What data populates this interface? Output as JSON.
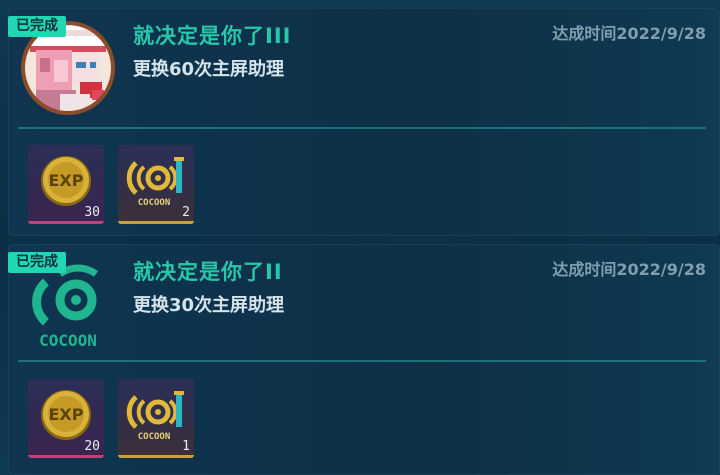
{
  "status_label": "已完成",
  "achievements": [
    {
      "title": "就决定是你了III",
      "description": "更换60次主屏助理",
      "date": "达成时间2022/9/28",
      "icon": "assistant-portrait-icon",
      "rewards": [
        {
          "type": "exp",
          "icon": "exp-coin-icon",
          "label": "EXP",
          "count": "30"
        },
        {
          "type": "cocoon",
          "icon": "cocoon-token-icon",
          "label": "COCOON",
          "count": "2"
        }
      ]
    },
    {
      "title": "就决定是你了II",
      "description": "更换30次主屏助理",
      "date": "达成时间2022/9/28",
      "icon": "cocoon-logo-icon",
      "logo_text": "COCOON",
      "rewards": [
        {
          "type": "exp",
          "icon": "exp-coin-icon",
          "label": "EXP",
          "count": "20"
        },
        {
          "type": "cocoon",
          "icon": "cocoon-token-icon",
          "label": "COCOON",
          "count": "1"
        }
      ]
    }
  ],
  "colors": {
    "badge": "#22d6b4",
    "title": "#27c7a8",
    "divider": "#1f7b86",
    "background": "#0d3348"
  }
}
